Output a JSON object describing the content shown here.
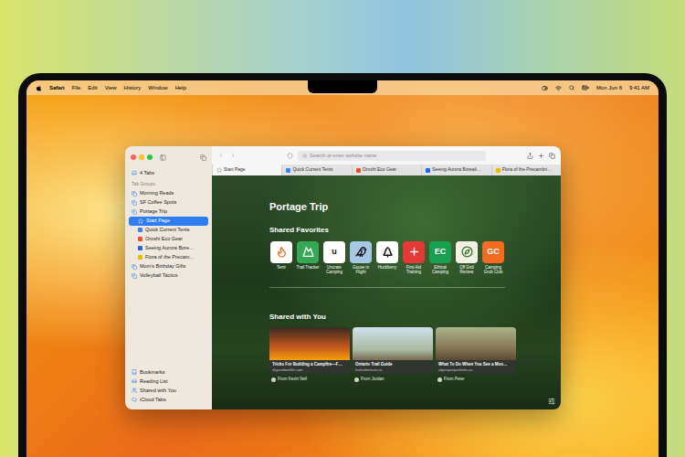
{
  "menu_bar": {
    "app": "Safari",
    "menus": [
      "File",
      "Edit",
      "View",
      "History",
      "Window",
      "Help"
    ],
    "date": "Mon Jun 6",
    "time": "9:41 AM"
  },
  "sidebar": {
    "all_tabs": "4 Tabs",
    "section": "Tab Groups",
    "groups": [
      {
        "label": "Morning Reads",
        "expanded": false,
        "tabs": []
      },
      {
        "label": "SF Coffee Spots",
        "expanded": false,
        "tabs": []
      },
      {
        "label": "Portage Trip",
        "expanded": true,
        "tabs": [
          {
            "label": "Start Page",
            "kind": "start-page",
            "selected": true,
            "color": "#8e8e93"
          },
          {
            "label": "Quick Current Tents",
            "kind": "site",
            "selected": false,
            "color": "#3b82f6"
          },
          {
            "label": "Oroshi Eco Gear",
            "kind": "site",
            "selected": false,
            "color": "#e8502f"
          },
          {
            "label": "Seeing Aurora Bore…",
            "kind": "site",
            "selected": false,
            "color": "#2563eb"
          },
          {
            "label": "Flora of the Precam…",
            "kind": "site",
            "selected": false,
            "color": "#e5c100"
          }
        ]
      },
      {
        "label": "Mom's Birthday Gifts",
        "expanded": false,
        "tabs": []
      },
      {
        "label": "Volleyball Tactics",
        "expanded": false,
        "tabs": []
      }
    ],
    "footer": [
      "Bookmarks",
      "Reading List",
      "Shared with You",
      "iCloud Tabs"
    ]
  },
  "toolbar": {
    "search_placeholder": "Search or enter website name"
  },
  "tabs": [
    {
      "label": "Start Page",
      "kind": "start-page",
      "selected": true,
      "color": "#8e8e93"
    },
    {
      "label": "Quick Current Tents",
      "kind": "site",
      "selected": false,
      "color": "#3b82f6"
    },
    {
      "label": "Oroshi Eco Gear",
      "kind": "site",
      "selected": false,
      "color": "#e8502f"
    },
    {
      "label": "Seeing Aurora Boreali…",
      "kind": "site",
      "selected": false,
      "color": "#2563eb"
    },
    {
      "label": "Flora of the Precambri…",
      "kind": "site",
      "selected": false,
      "color": "#e5c100"
    }
  ],
  "start_page": {
    "title": "Portage Trip",
    "favorites_heading": "Shared Favorites",
    "favorites": [
      {
        "label": "Tentr",
        "kind": "icon",
        "color": "#ffffff"
      },
      {
        "label": "Trail Tracker",
        "kind": "icon",
        "color": "#34a853"
      },
      {
        "label": "Uncrate Camping",
        "kind": "glyph",
        "glyph": "u",
        "color": "#ffffff"
      },
      {
        "label": "Goose in Flight",
        "kind": "icon",
        "color": "#a7c7e7"
      },
      {
        "label": "Huckberry",
        "kind": "icon",
        "color": "#ffffff"
      },
      {
        "label": "First Aid Training",
        "kind": "icon",
        "color": "#e53935"
      },
      {
        "label": "Ethical Camping",
        "kind": "glyph",
        "glyph": "EC",
        "color": "#1a9e50"
      },
      {
        "label": "Off Grid Review",
        "kind": "icon",
        "color": "#f3efe2"
      },
      {
        "label": "Camping Grub Club",
        "kind": "glyph",
        "glyph": "GC",
        "color": "#f26b21"
      }
    ],
    "shared_heading": "Shared with You",
    "shared": [
      {
        "title": "Tricks For Building a Campfire—F…",
        "site": "skyoutdoorlife.com",
        "from": "From Kevin Nell"
      },
      {
        "title": "Ontario Trail Guide",
        "site": "trailsofontario.ca",
        "from": "From Jordan"
      },
      {
        "title": "What To Do When You See a Moo…",
        "site": "algonquinparkinfo.ca",
        "from": "From Peter"
      }
    ]
  }
}
